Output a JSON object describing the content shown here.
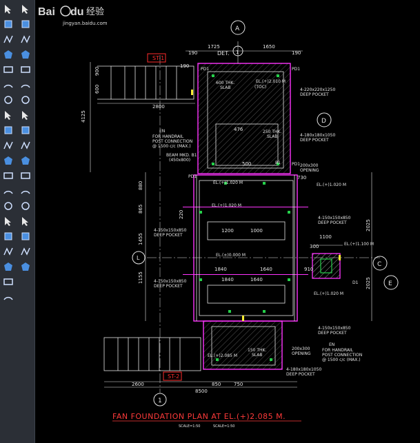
{
  "toolbar": {
    "left_icons": [
      "select-arrow-icon",
      "pentagon-icon",
      "polyline-icon",
      "polygon-icon",
      "rectangle-icon",
      "arc-icon",
      "circle-icon",
      "cloud-icon",
      "spline-icon",
      "ellipse-icon",
      "ellipse-arc-icon",
      "insert-block-icon",
      "make-block-icon",
      "point-icon",
      "hatch-icon",
      "gradient-icon",
      "region-icon",
      "table-icon",
      "multiline-text-icon",
      "add-selected-icon"
    ],
    "right_icons": [
      "erase-icon",
      "copy-icon",
      "mirror-icon",
      "offset-icon",
      "array-icon",
      "move-icon",
      "rotate-icon",
      "scale-icon",
      "stretch-icon",
      "trim-icon",
      "extend-icon",
      "break-at-point-icon",
      "break-icon",
      "join-icon",
      "chamfer-icon",
      "fillet-icon",
      "blend-icon",
      "explode-icon"
    ]
  },
  "drawing": {
    "title": "FAN FOUNDATION PLAN AT EL.(+)2.085 M.",
    "scale": "SCALE=1:50",
    "section_marks": {
      "a": "A",
      "c": "C",
      "d": "D",
      "e": "E",
      "l": "L",
      "one": "1"
    },
    "tags": {
      "st1": "ST-1",
      "st2": "ST-2",
      "det": "DET.",
      "pd1_a": "PD1",
      "pd1_b": "PD1",
      "pd1_c": "PD1",
      "pd1_d": "PD1",
      "b1": "B1",
      "en_top": "EN",
      "en_bot": "EN",
      "d1": "D1"
    },
    "dims": {
      "d1725": "1725",
      "d1650": "1650",
      "d190a": "190",
      "d190b": "190",
      "d190c": "190",
      "d2800": "2800",
      "d4125": "4125",
      "d900": "900",
      "d600": "600",
      "d1200": "1200",
      "d1000": "1000",
      "d880": "880",
      "d865": "865",
      "d1455": "1455",
      "d1155": "1155",
      "d2025a": "2025",
      "d2025b": "2025",
      "d1840a": "1840",
      "d1640a": "1640",
      "d1840b": "1840",
      "d1640b": "1640",
      "d8500": "8500",
      "d2600": "2600",
      "d850": "850",
      "d750": "750",
      "d910": "910",
      "d1100": "1100",
      "d300": "300",
      "d730": "730",
      "d220": "220",
      "d476": "476",
      "d500": "500"
    },
    "notes": {
      "el2010": "EL.(+)2.010 M",
      "toc": "(TOC)",
      "el2085": "EL.(+)2.085 M",
      "el1020a": "EL.(+)1.020 M",
      "el1020b": "EL.(+)1.020 M",
      "el1020c": "EL.(+)1.020 M",
      "el1020d": "EL.(+)1.020 M",
      "el1100": "EL.(+)1.100 M",
      "el0000": "EL.(±)0.000 M",
      "pocket_a": "4-220x220x1250",
      "pocket_a2": "DEEP POCKET",
      "pocket_b": "4-180x180x1050",
      "pocket_b2": "DEEP POCKET",
      "pocket_c": "4-150x150x850",
      "pocket_c2": "DEEP POCKET",
      "pocket_d": "4-150x150x850",
      "pocket_d2": "DEEP POCKET",
      "pocket_e": "4-150x150x850",
      "pocket_e2": "DEEP POCKET",
      "pocket_f": "4-150x150x850",
      "pocket_f2": "DEEP POCKET",
      "pocket_g": "4-180x180x1050",
      "pocket_g2": "DEEP POCKET",
      "opening_a": "200x300",
      "opening_a2": "OPENING",
      "opening_b": "200x300",
      "opening_b2": "OPENING",
      "handrail_a": "FOR HANDRAIL",
      "handrail_a2": "POST CONNECTION",
      "handrail_a3": "@ 1500 c/c (MAX.)",
      "handrail_b": "FOR HANDRAIL",
      "handrail_b2": "POST CONNECTION",
      "handrail_b3": "@ 1500 c/c (MAX.)",
      "slab_a": "600 THK.",
      "slab_a2": "SLAB",
      "slab_b": "250 THK.",
      "slab_b2": "SLAB",
      "slab_c": "150 THK.",
      "slab_c2": "SLAB",
      "beam": "BEAM MKD. B1",
      "beam2": "(450x800)"
    }
  },
  "watermark": {
    "brand": "Bai",
    "brand2": "du",
    "brand3": "经验",
    "url": "jingyan.baidu.com"
  },
  "colors": {
    "line_white": "#e6e6e6",
    "magenta": "#ff34ff",
    "green": "#25d04a",
    "red": "#ff2b2b",
    "yellow": "#ffee33",
    "cyan": "#44d8ff"
  }
}
